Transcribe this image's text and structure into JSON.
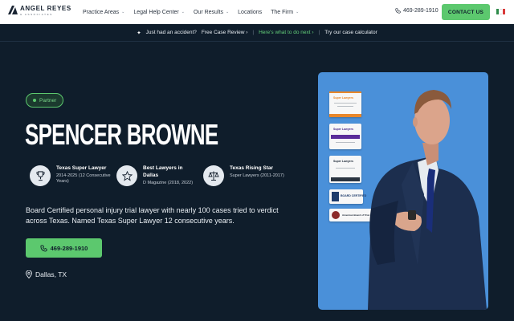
{
  "nav": {
    "logo_name": "ANGEL REYES",
    "logo_sub": "& ASSOCIATES",
    "items": [
      {
        "label": "Practice Areas",
        "dropdown": true
      },
      {
        "label": "Legal Help Center",
        "dropdown": true
      },
      {
        "label": "Our Results",
        "dropdown": true
      },
      {
        "label": "Locations",
        "dropdown": false
      },
      {
        "label": "The Firm",
        "dropdown": true
      }
    ],
    "phone": "469-289-1910",
    "contact_label": "CONTACT US",
    "language_flag": "mexico-flag-icon"
  },
  "banner": {
    "accident": "Just had an accident?",
    "free_review": "Free Case Review",
    "next_steps": "Here's what to do next",
    "calculator": "Try our case calculator",
    "accent_color": "#64d07a"
  },
  "hero": {
    "badge": "Partner",
    "name": "SPENCER BROWNE",
    "awards": [
      {
        "icon": "trophy-icon",
        "title": "Texas Super Lawyer",
        "sub": "2014-2025 (12 Consecutive Years)"
      },
      {
        "icon": "star-icon",
        "title": "Best Lawyers in Dallas",
        "sub": "D Magazine (2018, 2022)"
      },
      {
        "icon": "scales-icon",
        "title": "Texas Rising Star",
        "sub": "Super Lawyers (2011-2017)"
      }
    ],
    "description": "Board Certified personal injury trial lawyer with nearly 100 cases tried to verdict across Texas. Named Texas Super Lawyer 12 consecutive years.",
    "phone_cta": "469-289-1910",
    "location": "Dallas, TX"
  },
  "photo": {
    "certificates": [
      "Super Lawyers",
      "Super Lawyers",
      "Super Lawyers",
      "BOARD CERTIFIED",
      "American Board of Trial Advocates"
    ]
  },
  "colors": {
    "background": "#0f1d2b",
    "accent": "#5cc86e",
    "photo_bg": "#4a90d9"
  }
}
